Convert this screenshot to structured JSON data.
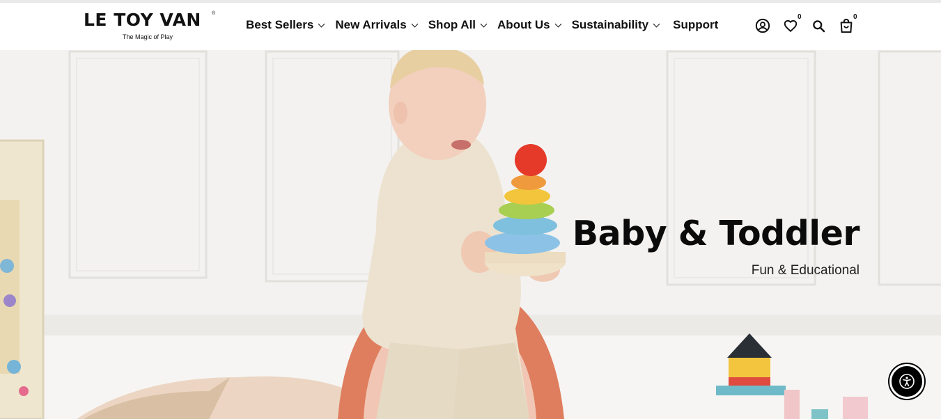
{
  "brand": {
    "name": "LE TOY VAN",
    "registered": "®",
    "tagline": "The Magic of Play"
  },
  "nav": {
    "items": [
      {
        "label": "Best Sellers",
        "has_dropdown": true
      },
      {
        "label": "New Arrivals",
        "has_dropdown": true
      },
      {
        "label": "Shop All",
        "has_dropdown": true
      },
      {
        "label": "About Us",
        "has_dropdown": true
      },
      {
        "label": "Sustainability",
        "has_dropdown": true
      },
      {
        "label": "Support",
        "has_dropdown": false
      }
    ]
  },
  "header_icons": {
    "account": "account-icon",
    "wishlist": "heart-icon",
    "wishlist_count": "0",
    "search": "search-icon",
    "cart": "shopping-bag-icon",
    "cart_count": "0"
  },
  "hero": {
    "title": "Baby & Toddler",
    "subtitle": "Fun & Educational",
    "image": "toddler-with-stacking-rings-photo"
  },
  "accessibility": {
    "icon": "accessibility-icon"
  },
  "colors": {
    "text": "#111111",
    "header_bg": "#ffffff",
    "hero_bg": "#f3f2f1",
    "a11y_button": "#000000"
  }
}
